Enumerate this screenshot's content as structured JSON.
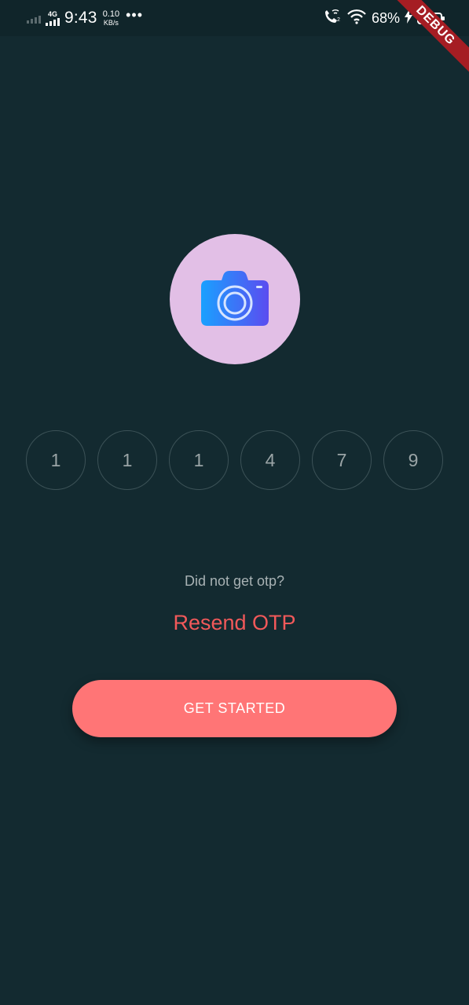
{
  "status_bar": {
    "network_type": "4G",
    "time": "9:43",
    "speed_value": "0.10",
    "speed_unit": "KB/s",
    "more": "•••",
    "battery_percent": "68%",
    "battery_level": 0.68,
    "icons": [
      "call-wifi-icon",
      "wifi-icon",
      "charging-icon",
      "battery-icon"
    ]
  },
  "debug_banner": {
    "label": "DEBUG",
    "color": "#a51d23"
  },
  "avatar": {
    "icon": "camera-icon",
    "background": "#e2bfe6"
  },
  "otp": {
    "digits": [
      "1",
      "1",
      "1",
      "4",
      "7",
      "9"
    ]
  },
  "prompt_text": "Did not get otp?",
  "resend_label": "Resend OTP",
  "cta_label": "GET STARTED",
  "colors": {
    "background": "#132a30",
    "accent": "#ff7576",
    "resend": "#f2595a"
  }
}
